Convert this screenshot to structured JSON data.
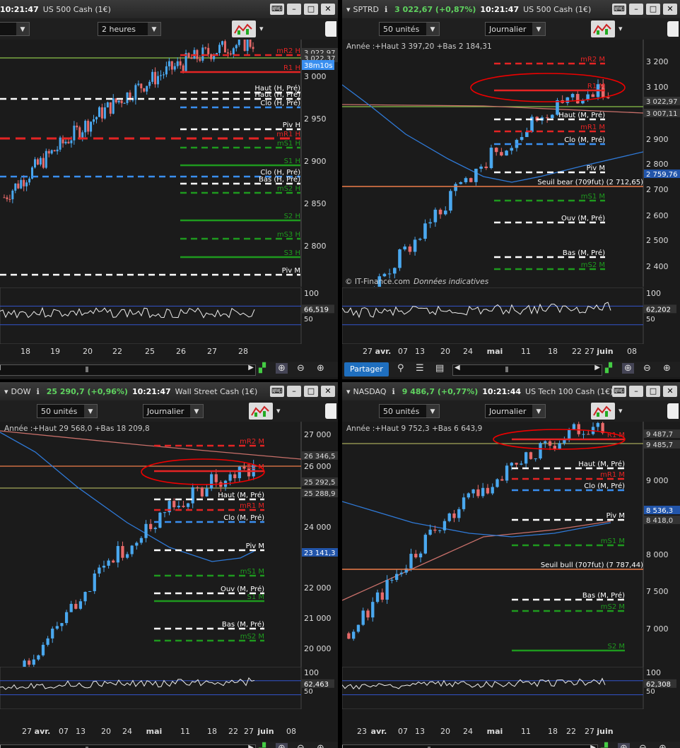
{
  "colors": {
    "bull": "#4aa8ef",
    "bear": "#e86a6a",
    "red": "#ee2222",
    "green": "#1f9e1f",
    "white": "#ffffff",
    "blue": "#3a8ff0",
    "orange": "#f07c4a",
    "olive": "#a5a85a"
  },
  "panels": [
    {
      "id": "sp500",
      "symbol": "",
      "change": "",
      "time": "10:21:47",
      "name": "US 500 Cash (1€)",
      "units_select": "s",
      "period_select": "2 heures",
      "header_text": "",
      "yticks": [
        "3 000",
        "2 950",
        "2 900",
        "2 850",
        "2 800"
      ],
      "yaxis_top_label": "",
      "price_tags": [
        "3 022,97",
        "3 022,37"
      ],
      "timer": "38m10s",
      "levels": [
        "mR2 H",
        "R1 H",
        "Haut (H, Pré)",
        "Haut (H, Pré)",
        "Clo (H, Pré)",
        "Piv H",
        "mR1 H",
        "mS1 H",
        "S1 H",
        "Clo (H, Pré)",
        "Bas (H, Pré)",
        "mS2 H",
        "S2 H",
        "mS3 H",
        "S3 H",
        "Piv M"
      ],
      "osc_ticks": [
        "100",
        "50"
      ],
      "osc_value": "66,519",
      "xlabels": [
        "18",
        "19",
        "20",
        "22",
        "25",
        "26",
        "27",
        "28"
      ],
      "copyright": "",
      "disclaimer": ""
    },
    {
      "id": "sptrd",
      "symbol": "SPTRD",
      "change": "3 022,67 (+0,87%)",
      "time": "10:21:47",
      "name": "US 500 Cash (1€)",
      "units_select": "50 unités",
      "period_select": "Journalier",
      "header_text": "Année :+Haut 3 397,20 +Bas 2 184,31",
      "yticks": [
        "3 200",
        "3 100",
        "2 900",
        "2 800",
        "2 700",
        "2 600",
        "2 500",
        "2 400"
      ],
      "price_tags": [
        "3 022,97",
        "3 007,11",
        "2 759,76"
      ],
      "levels": [
        "mR2 M",
        "R1 M",
        "Haut (M, Pré)",
        "mR1 M",
        "Clo (M, Pré)",
        "Piv M",
        "Seuil bear (709fut) (2 712,65)",
        "mS1 M",
        "Ouv (M, Pré)",
        "Bas (M, Pré)",
        "mS2 M"
      ],
      "osc_ticks": [
        "100",
        "50"
      ],
      "osc_value": "62,202",
      "xlabels": [
        "27",
        "avr.",
        "07",
        "13",
        "20",
        "24",
        "mai",
        "11",
        "18",
        "22",
        "27",
        "juin",
        "08"
      ],
      "copyright": "© IT-Finance.com",
      "disclaimer": "Données indicatives",
      "share_label": "Partager"
    },
    {
      "id": "dow",
      "symbol": "DOW",
      "change": "25 290,7 (+0,96%)",
      "time": "10:21:47",
      "name": "Wall Street Cash (1€)",
      "units_select": "50 unités",
      "period_select": "Journalier",
      "header_text": "Année :+Haut 29 568,0 +Bas 18 209,8",
      "yticks": [
        "27 000",
        "26 000",
        "24 000",
        "22 000",
        "21 000",
        "20 000"
      ],
      "price_tags": [
        "26 346,5",
        "25 292,5",
        "25 288,9",
        "23 141,3"
      ],
      "levels": [
        "mR2 M",
        "R1 M",
        "Haut (M, Pré)",
        "mR1 M",
        "Clo (M, Pré)",
        "Piv M",
        "mS1 M",
        "Ouv (M, Pré)",
        "S1 M",
        "Bas (M, Pré)",
        "mS2 M"
      ],
      "osc_ticks": [
        "100",
        "50"
      ],
      "osc_value": "62,463",
      "xlabels": [
        "27",
        "avr.",
        "07",
        "13",
        "20",
        "24",
        "mai",
        "11",
        "18",
        "22",
        "27",
        "juin",
        "08"
      ],
      "copyright": "© IT-Finance.com",
      "disclaimer": "Données indicatives"
    },
    {
      "id": "nasdaq",
      "symbol": "NASDAQ",
      "change": "9 486,7 (+0,77%)",
      "time": "10:21:44",
      "name": "US Tech 100 Cash (1€)",
      "units_select": "50 unités",
      "period_select": "Journalier",
      "header_text": "Année :+Haut 9 752,3 +Bas 6 643,9",
      "yticks": [
        "9 000",
        "8 000",
        "7 500",
        "7 000"
      ],
      "price_tags": [
        "9 487,7",
        "9 485,7",
        "8 536,3",
        "8 418,0"
      ],
      "levels": [
        "R1 M",
        "Haut (M, Pré)",
        "mR1 M",
        "Clo (M, Pré)",
        "Piv M",
        "mS1 M",
        "Seuil bull (707fut) (7 787,44)",
        "Bas (M, Pré)",
        "mS2 M",
        "S2 M"
      ],
      "osc_ticks": [
        "100",
        "50"
      ],
      "osc_value": "62,308",
      "xlabels": [
        "23",
        "avr.",
        "07",
        "13",
        "20",
        "24",
        "mai",
        "11",
        "18",
        "22",
        "27",
        "juin"
      ],
      "copyright": "© IT-Finance.com",
      "disclaimer": "Données indicatives"
    }
  ]
}
